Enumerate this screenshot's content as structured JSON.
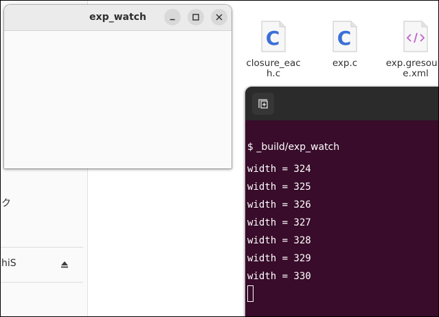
{
  "app_window": {
    "title": "exp_watch"
  },
  "file_manager": {
    "sidebar_fragments": [
      "ク",
      "hiS"
    ],
    "files": [
      {
        "name": "closure_each.c",
        "display": "closure_eac h.c",
        "icon": "c-source-file-icon"
      },
      {
        "name": "exp.c",
        "display": "exp.c",
        "icon": "c-source-file-icon"
      },
      {
        "name": "exp.gresource.xml",
        "display": "exp.gresou ce.xml",
        "icon": "xml-file-icon"
      }
    ]
  },
  "terminal": {
    "prompt": "$ _build/exp_watch",
    "output": [
      "width = 324",
      "width = 325",
      "width = 326",
      "width = 327",
      "width = 328",
      "width = 329",
      "width = 330"
    ]
  },
  "colors": {
    "terminal_bg": "#380c2a",
    "terminal_header": "#2b2b2b",
    "c_icon_accent": "#3a6fd8",
    "xml_icon_accent": "#c061cb"
  }
}
